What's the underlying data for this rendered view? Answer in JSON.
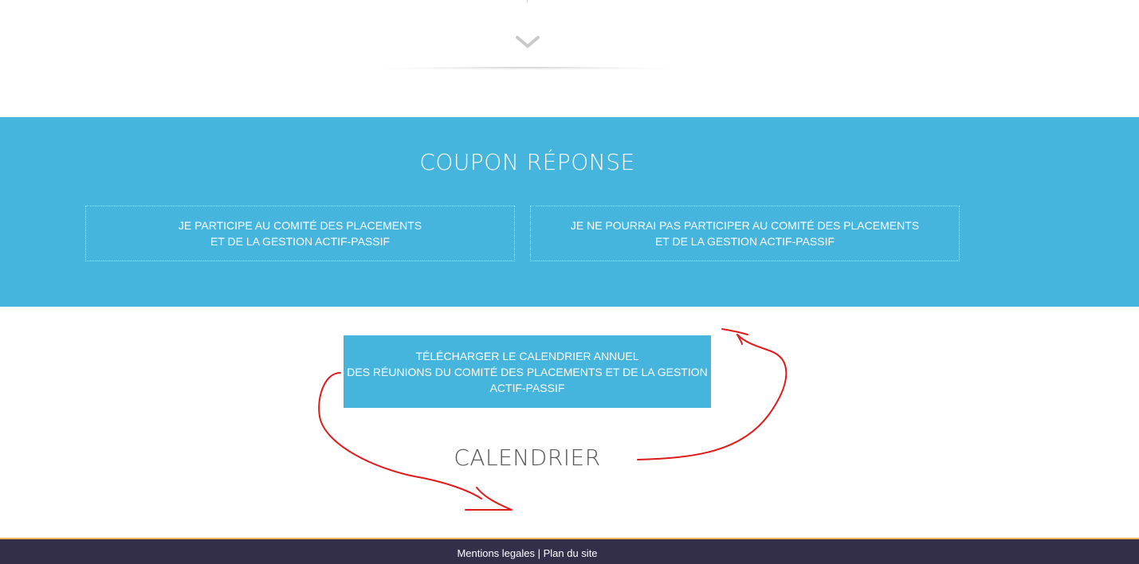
{
  "coupon": {
    "title": "COUPON RÉPONSE",
    "background_color": "#45b5dd",
    "yes_button": {
      "line1": "JE PARTICIPE AU COMITÉ DES PLACEMENTS",
      "line2": "ET DE LA GESTION ACTIF-PASSIF"
    },
    "no_button": {
      "line1": "JE NE POURRAI PAS PARTICIPER AU COMITÉ DES PLACEMENTS",
      "line2": "ET DE LA GESTION ACTIF-PASSIF"
    }
  },
  "download": {
    "line1": "TÉLÉCHARGER LE CALENDRIER ANNUEL",
    "line2": "DES RÉUNIONS DU COMITÉ DES PLACEMENTS ET DE LA GESTION",
    "line3": "ACTIF-PASSIF"
  },
  "calendar": {
    "title": "CALENDRIER"
  },
  "footer": {
    "legal_link": "Mentions legales",
    "separator": " | ",
    "sitemap_link": "Plan du site",
    "background_color": "#332f4a",
    "accent_color": "#f2b15a"
  },
  "annotation": {
    "color": "#e01b1b"
  },
  "icons": {
    "scroll": "chevron-down-icon"
  }
}
